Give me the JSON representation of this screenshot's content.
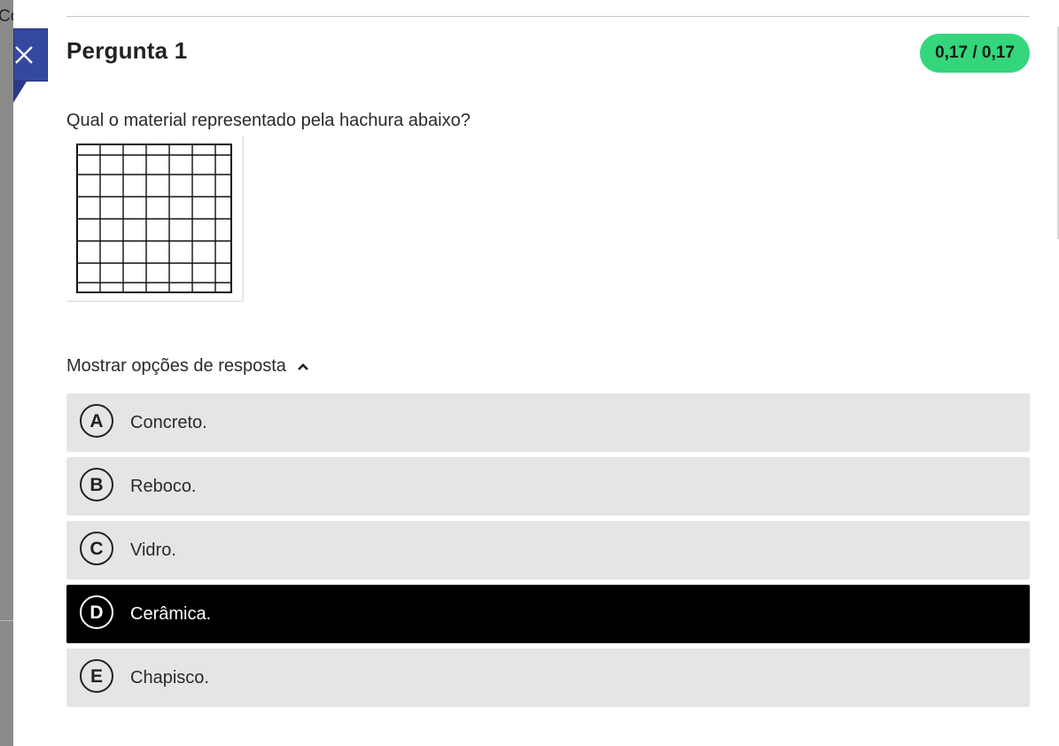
{
  "background": {
    "partial_text": "Co"
  },
  "header": {
    "title": "Pergunta 1",
    "score": "0,17 / 0,17",
    "score_color": "#33d67b",
    "close_icon": "close-icon",
    "accent": "#3448a0"
  },
  "question": {
    "text": "Qual o material representado pela hachura abaixo?",
    "image": "grid-hatch-pattern"
  },
  "answers": {
    "toggle_label": "Mostrar opções de resposta",
    "toggle_icon": "chevron-up-icon",
    "options": [
      {
        "letter": "A",
        "text": "Concreto.",
        "selected": false
      },
      {
        "letter": "B",
        "text": "Reboco.",
        "selected": false
      },
      {
        "letter": "C",
        "text": "Vidro.",
        "selected": false
      },
      {
        "letter": "D",
        "text": "Cerâmica.",
        "selected": true
      },
      {
        "letter": "E",
        "text": "Chapisco.",
        "selected": false
      }
    ]
  }
}
